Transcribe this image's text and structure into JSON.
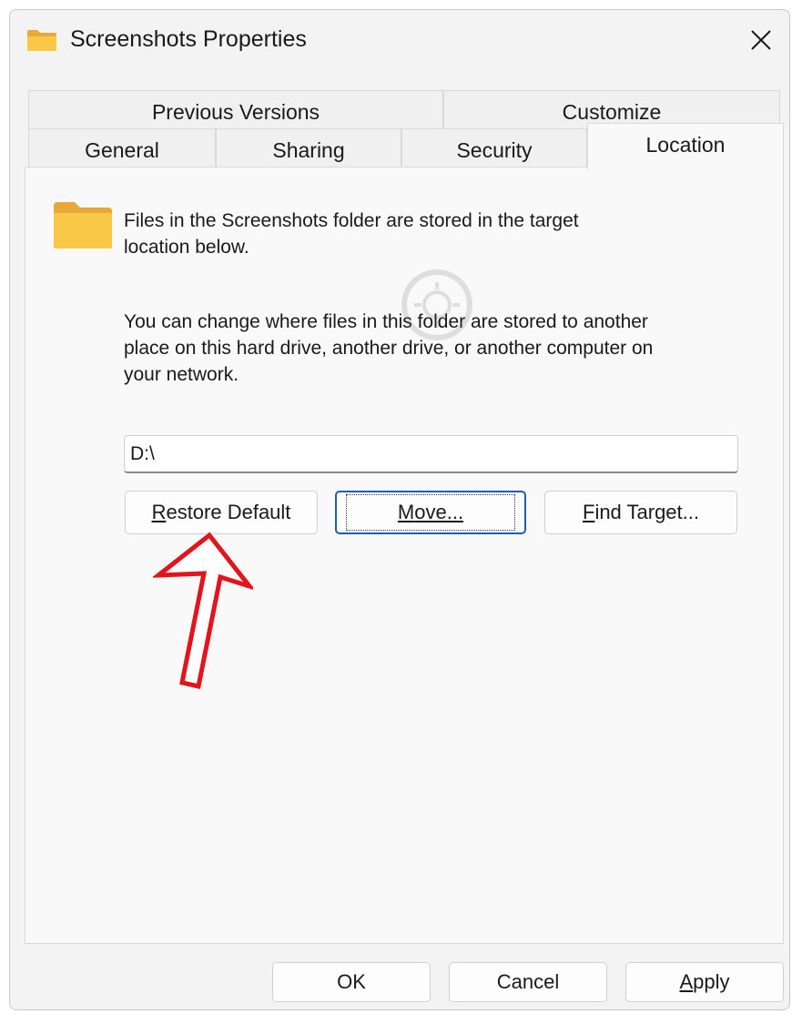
{
  "window": {
    "title": "Screenshots Properties"
  },
  "tabs": {
    "row1": [
      {
        "label": "Previous Versions"
      },
      {
        "label": "Customize"
      }
    ],
    "row2": [
      {
        "label": "General"
      },
      {
        "label": "Sharing"
      },
      {
        "label": "Security"
      },
      {
        "label": "Location",
        "active": true
      }
    ]
  },
  "location": {
    "intro_line1": "Files in the Screenshots folder are stored in the target",
    "intro_line2": "location below.",
    "desc_line1": "You can change where files in this folder are stored to another",
    "desc_line2": "place on this hard drive, another drive, or another computer on",
    "desc_line3": "your network.",
    "path_value": "D:\\",
    "restore_pre": "",
    "restore_u": "R",
    "restore_post": "estore Default",
    "move_u": "M",
    "move_post": "ove...",
    "find_u": "F",
    "find_post": "ind Target..."
  },
  "footer": {
    "ok_label": "OK",
    "cancel_label": "Cancel",
    "apply_u": "A",
    "apply_post": "pply"
  },
  "colors": {
    "accent": "#1a5fb4",
    "annotation_arrow": "#e3141b",
    "folder_yellow": "#f8c846"
  },
  "icons": [
    "folder-icon",
    "close-icon",
    "arrow-annotation-icon"
  ]
}
